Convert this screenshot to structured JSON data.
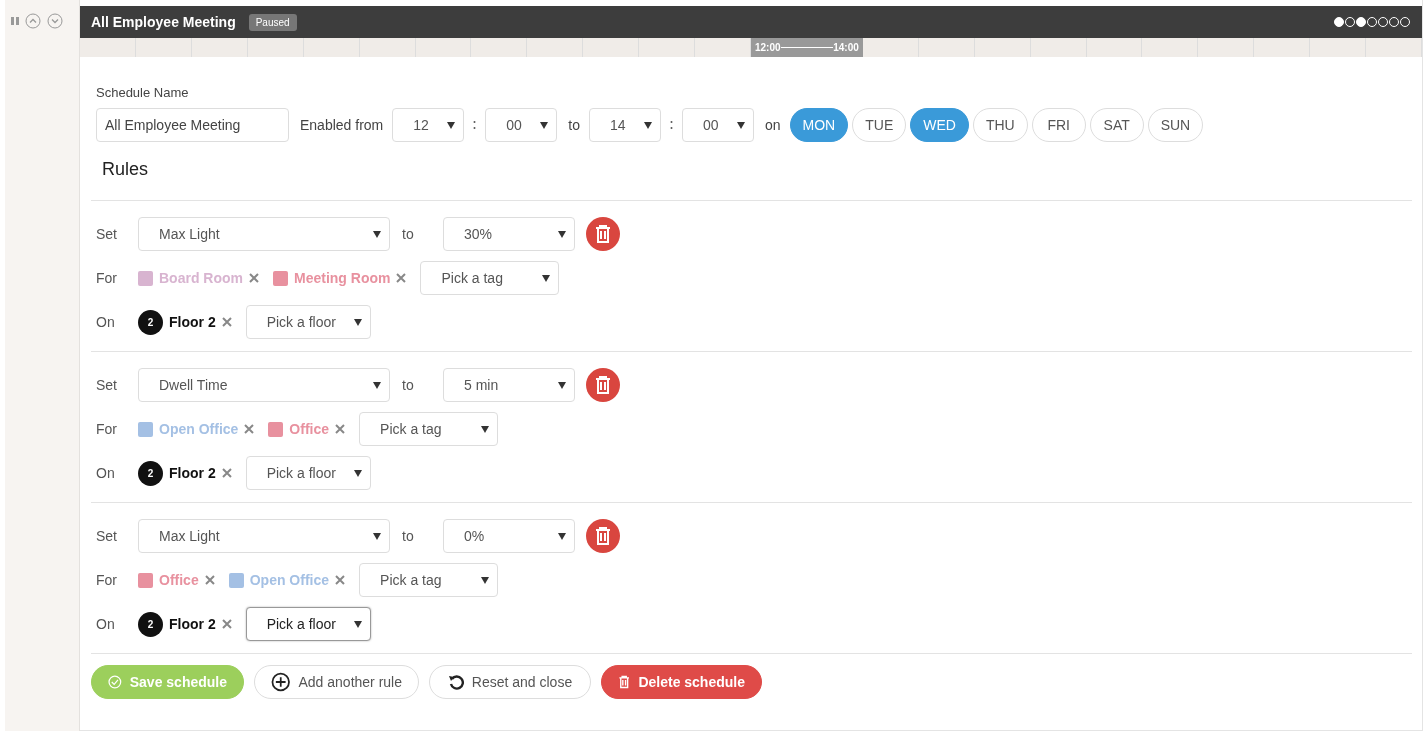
{
  "schedule": {
    "title": "All Employee Meeting",
    "status": "Paused",
    "timeline": {
      "start": "12:00",
      "end": "14:00"
    }
  },
  "form": {
    "name_label": "Schedule Name",
    "name_value": "All Employee Meeting",
    "enabled_label": "Enabled from",
    "from_hour": "12",
    "from_minute": "00",
    "to_label": "to",
    "to_hour": "14",
    "to_minute": "00",
    "on_label": "on",
    "days": [
      {
        "label": "MON",
        "selected": true
      },
      {
        "label": "TUE",
        "selected": false
      },
      {
        "label": "WED",
        "selected": true
      },
      {
        "label": "THU",
        "selected": false
      },
      {
        "label": "FRI",
        "selected": false
      },
      {
        "label": "SAT",
        "selected": false
      },
      {
        "label": "SUN",
        "selected": false
      }
    ]
  },
  "rules_heading": "Rules",
  "rules": [
    {
      "set_label": "Set",
      "property": "Max Light",
      "to_label": "to",
      "value": "30%",
      "for_label": "For",
      "tags": [
        {
          "label": "Board Room",
          "color": "#d8b4d0"
        },
        {
          "label": "Meeting Room",
          "color": "#e8919f"
        }
      ],
      "tag_placeholder": "Pick a tag",
      "on_label": "On",
      "floors": [
        {
          "number": "2",
          "label": "Floor 2"
        }
      ],
      "floor_placeholder": "Pick a floor",
      "floor_focused": false
    },
    {
      "set_label": "Set",
      "property": "Dwell Time",
      "to_label": "to",
      "value": "5 min",
      "for_label": "For",
      "tags": [
        {
          "label": "Open Office",
          "color": "#a4c0e4"
        },
        {
          "label": "Office",
          "color": "#e8919f"
        }
      ],
      "tag_placeholder": "Pick a tag",
      "on_label": "On",
      "floors": [
        {
          "number": "2",
          "label": "Floor 2"
        }
      ],
      "floor_placeholder": "Pick a floor",
      "floor_focused": false
    },
    {
      "set_label": "Set",
      "property": "Max Light",
      "to_label": "to",
      "value": "0%",
      "for_label": "For",
      "tags": [
        {
          "label": "Office",
          "color": "#e8919f"
        },
        {
          "label": "Open Office",
          "color": "#a4c0e4"
        }
      ],
      "tag_placeholder": "Pick a tag",
      "on_label": "On",
      "floors": [
        {
          "number": "2",
          "label": "Floor 2"
        }
      ],
      "floor_placeholder": "Pick a floor",
      "floor_focused": true
    }
  ],
  "actions": [
    {
      "kind": "save",
      "label": "Save schedule"
    },
    {
      "kind": "add",
      "label": "Add another rule"
    },
    {
      "kind": "reset",
      "label": "Reset and close"
    },
    {
      "kind": "delete",
      "label": "Delete schedule"
    }
  ]
}
